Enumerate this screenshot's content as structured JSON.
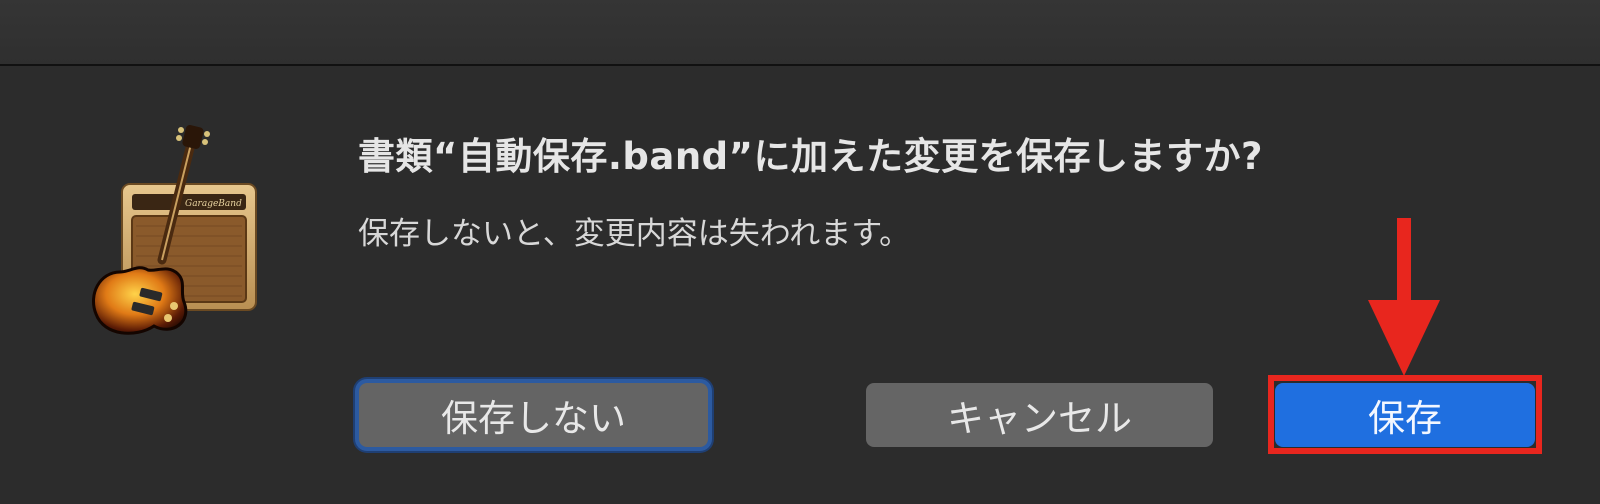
{
  "dialog": {
    "title": "書類“自動保存.band”に加えた変更を保存しますか?",
    "message": "保存しないと、変更内容は失われます。",
    "app_icon": "garageband-app-icon"
  },
  "buttons": {
    "dont_save": "保存しない",
    "cancel": "キャンセル",
    "save": "保存"
  },
  "annotation": {
    "color": "#e8261e",
    "target": "save-button"
  },
  "colors": {
    "dialog_background": "#2c2c2c",
    "primary_button": "#1f6fe0",
    "secondary_button": "#646464",
    "focus_ring": "#2c5aa0"
  }
}
